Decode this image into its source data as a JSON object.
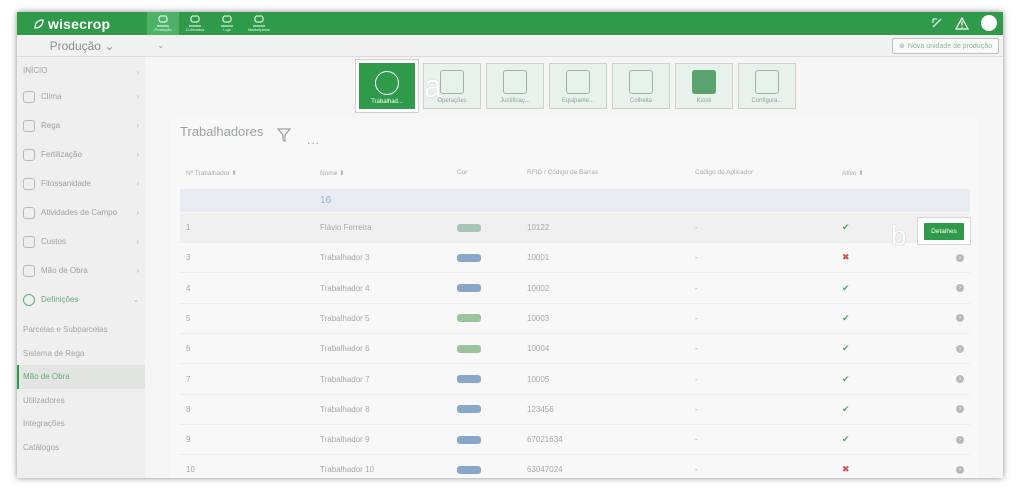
{
  "app": {
    "brand": "wisecrop"
  },
  "topnav": [
    {
      "label": "Produção",
      "icon": "tractor-icon"
    },
    {
      "label": "Cultivados",
      "icon": "plant-icon"
    },
    {
      "label": "Loja",
      "icon": "store-icon"
    },
    {
      "label": "Marketplace",
      "icon": "marketplace-icon"
    }
  ],
  "subbar": {
    "production_selector": "Produção",
    "new_unit_button": "Nova unidade de produção"
  },
  "sidebar": {
    "home": "INÍCIO",
    "items": [
      "Clima",
      "Rega",
      "Fertilização",
      "Fitossanidade",
      "Atividades de Campo",
      "Custos",
      "Mão de Obra"
    ],
    "definitions": "Definições",
    "links": [
      "Parcelas e Subparcelas",
      "Sistema de Rega",
      "Mão de Obra",
      "Utilizadores",
      "Integrações",
      "Catálogos"
    ],
    "active_link_index": 2
  },
  "tiles": [
    {
      "label": "Trabalhad...",
      "icon": "worker-hat-icon",
      "active": true
    },
    {
      "label": "Operações",
      "icon": "list-icon"
    },
    {
      "label": "Justificaç...",
      "icon": "document-check-icon"
    },
    {
      "label": "Equipame...",
      "icon": "tractor-icon"
    },
    {
      "label": "Colheita",
      "icon": "harvest-icon"
    },
    {
      "label": "Kiosk",
      "icon": "kiosk-grid-icon"
    },
    {
      "label": "Configura...",
      "icon": "tools-icon"
    }
  ],
  "callouts": {
    "a": "a",
    "b": "b"
  },
  "table": {
    "title": "Trabalhadores",
    "more": "...",
    "headers": [
      "Nº Trabalhador ⬍",
      "Nome ⬍",
      "Cor",
      "RFID / Código de Barras",
      "Código do Aplicador",
      "Ativo ⬍"
    ],
    "count": "16",
    "rows": [
      {
        "num": "1",
        "name": "Flávio Ferreira",
        "color": "#a9c5b8",
        "rfid": "10122",
        "applicator": "-",
        "active": true
      },
      {
        "num": "3",
        "name": "Trabalhador 3",
        "color": "#8aa6c8",
        "rfid": "10001",
        "applicator": "-",
        "active": false
      },
      {
        "num": "4",
        "name": "Trabalhador 4",
        "color": "#8aa6c8",
        "rfid": "10002",
        "applicator": "-",
        "active": true
      },
      {
        "num": "5",
        "name": "Trabalhador 5",
        "color": "#9cc49c",
        "rfid": "10003",
        "applicator": "-",
        "active": true
      },
      {
        "num": "6",
        "name": "Trabalhador 6",
        "color": "#9cc49c",
        "rfid": "10004",
        "applicator": "-",
        "active": true
      },
      {
        "num": "7",
        "name": "Trabalhador 7",
        "color": "#8aa6c8",
        "rfid": "10005",
        "applicator": "-",
        "active": true
      },
      {
        "num": "8",
        "name": "Trabalhador 8",
        "color": "#8aa6c8",
        "rfid": "123456",
        "applicator": "-",
        "active": true
      },
      {
        "num": "9",
        "name": "Trabalhador 9",
        "color": "#8aa6c8",
        "rfid": "67021634",
        "applicator": "-",
        "active": true
      },
      {
        "num": "10",
        "name": "Trabalhador 10",
        "color": "#8aa6c8",
        "rfid": "63047024",
        "applicator": "-",
        "active": false
      }
    ],
    "details_button": "Detalhes"
  }
}
